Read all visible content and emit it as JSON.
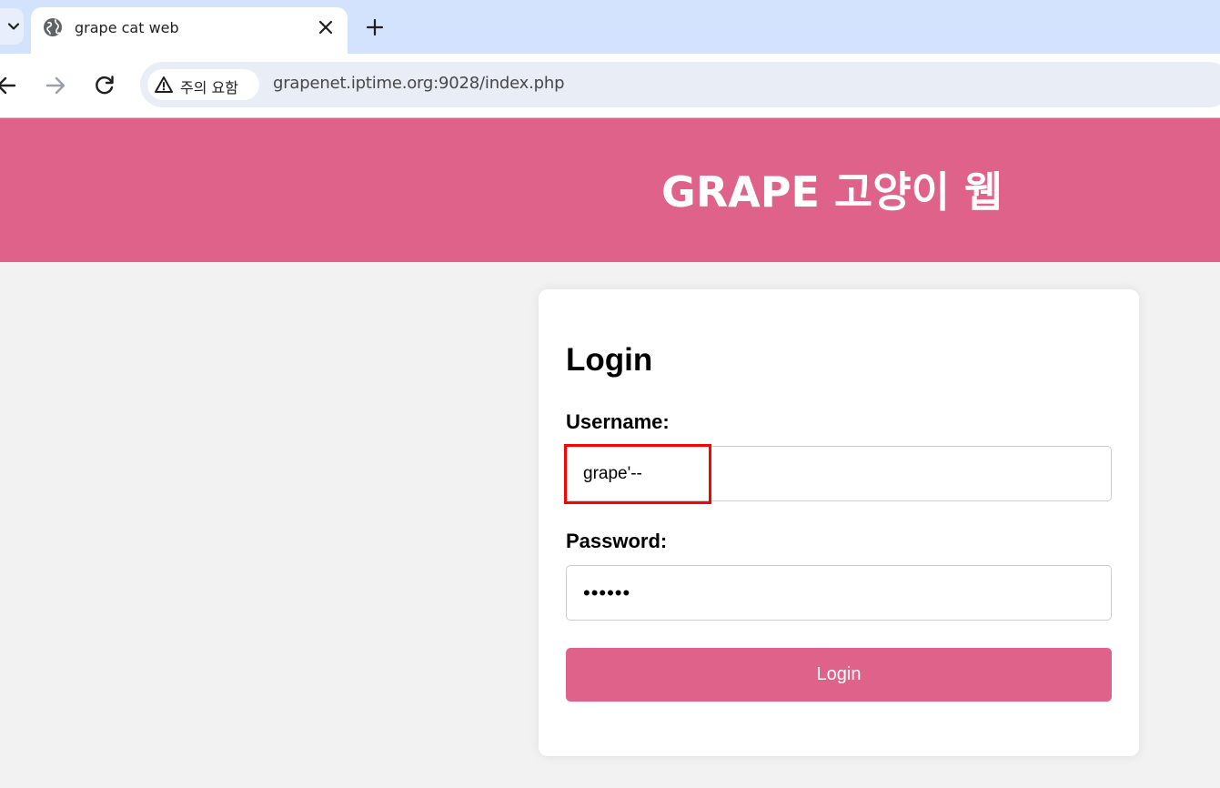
{
  "browser": {
    "tab": {
      "title": "grape cat web",
      "favicon": "globe-icon"
    },
    "icons": {
      "tab_menu": "chevron-down-icon",
      "tab_close": "close-icon",
      "new_tab": "plus-icon",
      "back": "back-arrow-icon",
      "forward": "forward-arrow-icon",
      "reload": "reload-icon",
      "security": "warning-triangle-icon"
    },
    "security_label": "주의 요함",
    "url": "grapenet.iptime.org:9028/index.php"
  },
  "page": {
    "header_title": "GRAPE 고양이 웹",
    "login": {
      "heading": "Login",
      "username_label": "Username:",
      "username_value": "grape'--",
      "password_label": "Password:",
      "password_display": "••••••",
      "submit_label": "Login"
    }
  },
  "colors": {
    "accent": "#de6289",
    "tabstrip": "#d3e3fd",
    "highlight": "#ff0000",
    "page_bg": "#f2f2f2"
  }
}
